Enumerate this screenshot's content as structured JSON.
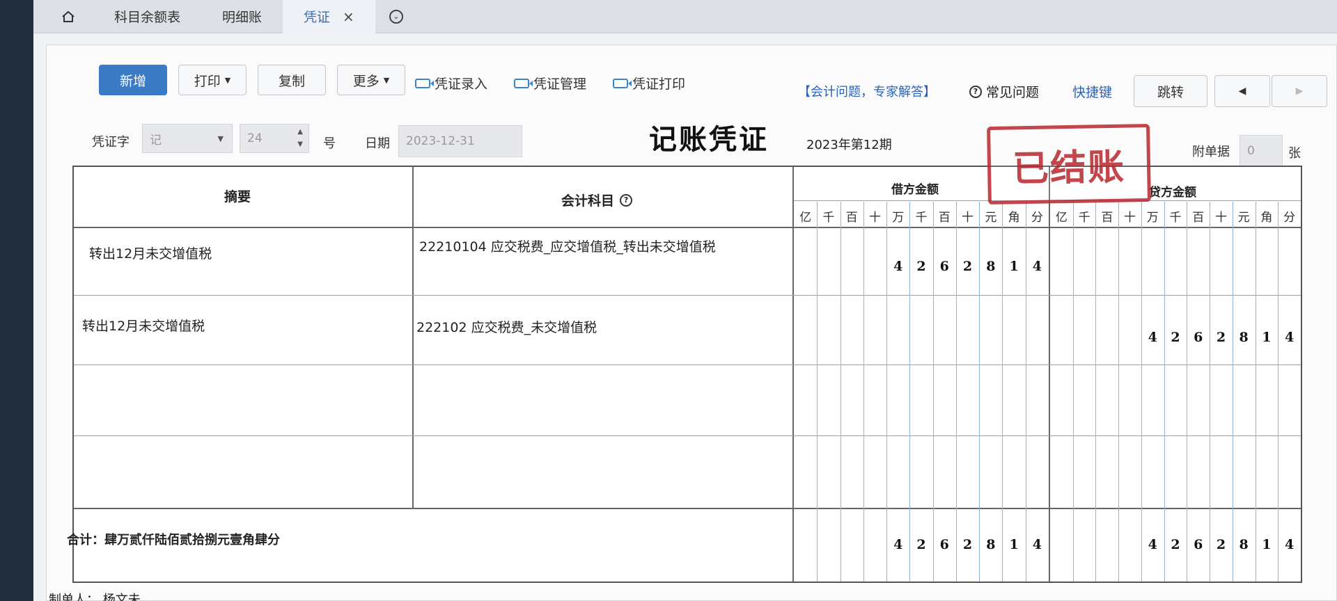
{
  "tabs": {
    "home_icon": "home-icon",
    "items": [
      "科目余额表",
      "明细账",
      "凭证"
    ],
    "active_close": "×",
    "more_icon": "chevron-circle-icon"
  },
  "toolbar": {
    "new_label": "新增",
    "print_label": "打印",
    "copy_label": "复制",
    "more_label": "更多",
    "links": [
      "凭证录入",
      "凭证管理",
      "凭证打印"
    ],
    "expert_link": "【会计问题，专家解答】",
    "faq_label": "常见问题",
    "shortcut_label": "快捷键",
    "jump_label": "跳转",
    "prev_icon": "◀",
    "next_icon": "▶"
  },
  "voucher": {
    "word_label": "凭证字",
    "word_value": "记",
    "number_value": "24",
    "number_suffix": "号",
    "date_label": "日期",
    "date_value": "2023-12-31",
    "title": "记账凭证",
    "period": "2023年第12期",
    "stamp": "已结账",
    "attach_label": "附单据",
    "attach_value": "0",
    "attach_unit": "张"
  },
  "table": {
    "col_summary": "摘要",
    "col_account": "会计科目",
    "col_debit": "借方金额",
    "col_credit": "贷方金额",
    "digit_headers": [
      "亿",
      "千",
      "百",
      "十",
      "万",
      "千",
      "百",
      "十",
      "元",
      "角",
      "分"
    ],
    "rows": [
      {
        "summary": "转出12月未交增值税",
        "account": "22210104 应交税费_应交增值税_转出未交增值税",
        "debit": "4262814",
        "credit": ""
      },
      {
        "summary": "转出12月未交增值税",
        "account": "222102 应交税费_未交增值税",
        "debit": "",
        "credit": "4262814"
      },
      {
        "summary": "",
        "account": "",
        "debit": "",
        "credit": ""
      },
      {
        "summary": "",
        "account": "",
        "debit": "",
        "credit": ""
      }
    ],
    "total_label": "合计：肆万贰仟陆佰贰拾捌元壹角肆分",
    "total_debit": "4262814",
    "total_credit": "4262814"
  },
  "footer": {
    "maker_label": "制单人：",
    "maker_name": "杨文未"
  }
}
